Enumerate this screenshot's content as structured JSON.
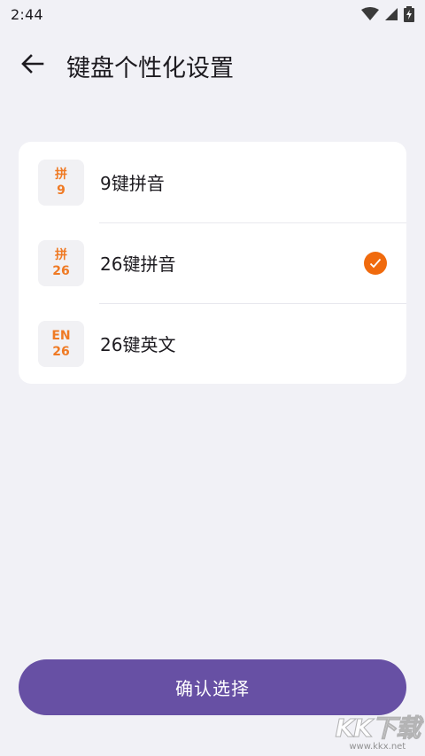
{
  "status_bar": {
    "time": "2:44"
  },
  "header": {
    "title": "键盘个性化设置"
  },
  "options": [
    {
      "badge_top": "拼",
      "badge_bottom": "9",
      "label": "9键拼音",
      "selected": false
    },
    {
      "badge_top": "拼",
      "badge_bottom": "26",
      "label": "26键拼音",
      "selected": true
    },
    {
      "badge_top": "EN",
      "badge_bottom": "26",
      "label": "26键英文",
      "selected": false
    }
  ],
  "confirm_label": "确认选择",
  "watermark": {
    "logo_text": "KK下载",
    "url": "www.kkx.net"
  },
  "colors": {
    "accent": "#6750a4",
    "badge_text": "#ef7a24",
    "check": "#f06a0d",
    "background": "#f1f1f6"
  }
}
